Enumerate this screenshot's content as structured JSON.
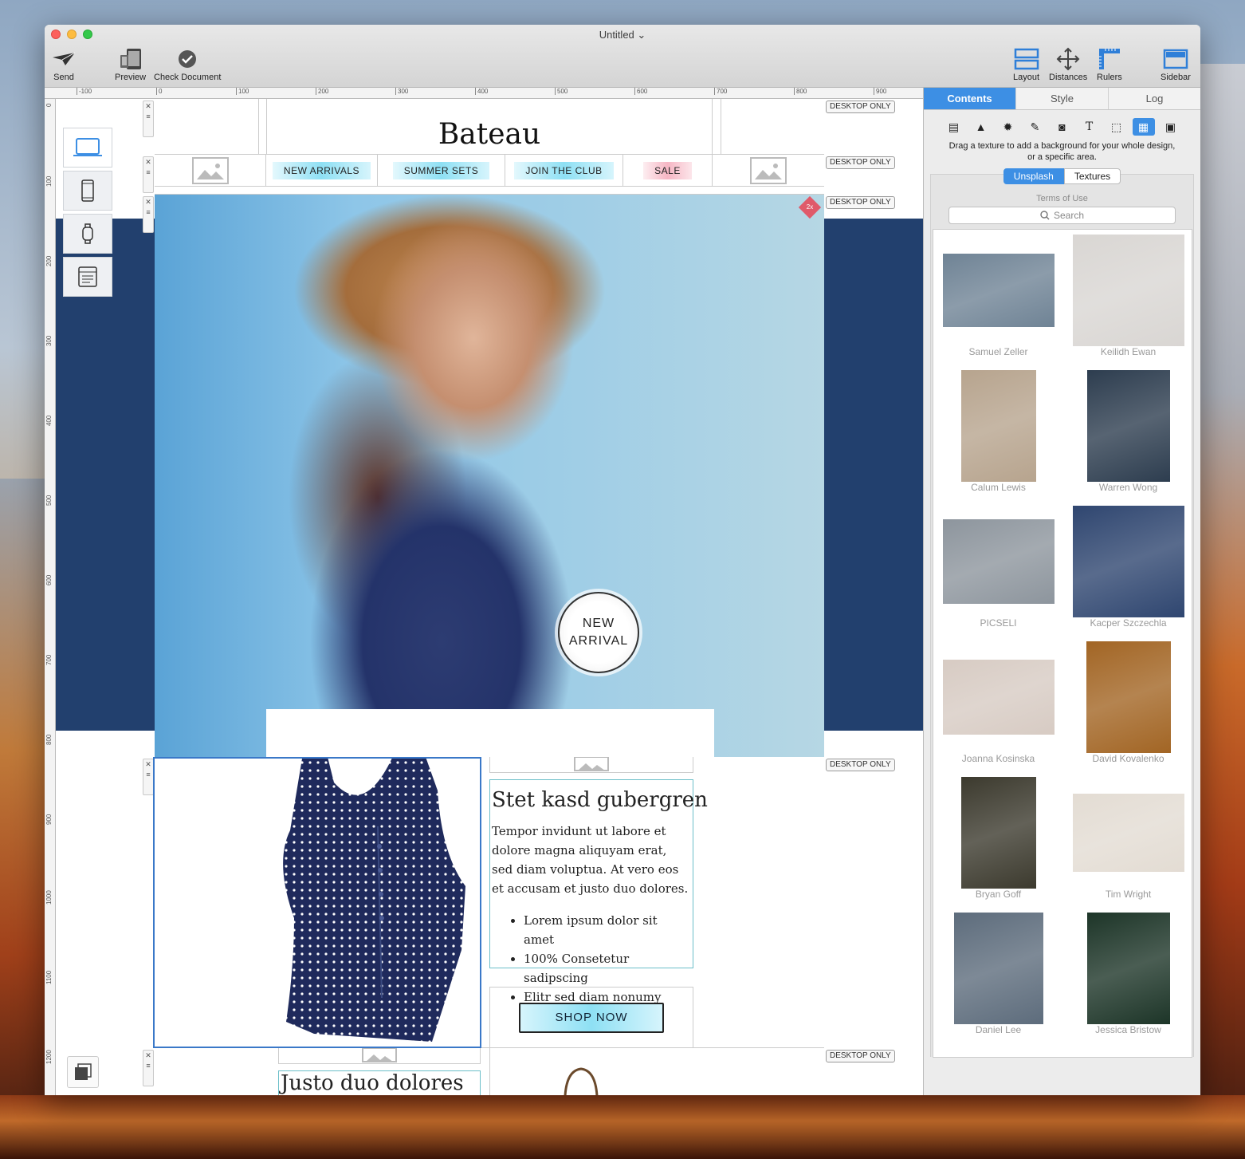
{
  "window": {
    "title": "Untitled"
  },
  "toolbar": {
    "left": [
      {
        "label": "Send",
        "icon": "paper-plane-icon"
      },
      {
        "label": "Preview",
        "icon": "devices-icon"
      },
      {
        "label": "Check Document",
        "icon": "checkmark-icon"
      }
    ],
    "right": [
      {
        "label": "Layout",
        "icon": "layout-icon"
      },
      {
        "label": "Distances",
        "icon": "distances-icon"
      },
      {
        "label": "Rulers",
        "icon": "rulers-icon"
      },
      {
        "label": "Sidebar",
        "icon": "sidebar-icon"
      }
    ]
  },
  "rulers": {
    "horizontal": [
      "-100",
      "0",
      "100",
      "200",
      "300",
      "400",
      "500",
      "600",
      "700",
      "800",
      "900"
    ],
    "vertical": [
      "0",
      "100",
      "200",
      "300",
      "400",
      "500",
      "600",
      "700",
      "800",
      "900",
      "1000",
      "1100",
      "1200"
    ]
  },
  "email": {
    "brand": "Bateau",
    "nav": [
      "NEW ARRIVALS",
      "SUMMER SETS",
      "JOIN THE CLUB",
      "SALE"
    ],
    "desktop_only": "DESKTOP ONLY",
    "hero_badge": "2x",
    "new_arrival": {
      "line1": "NEW",
      "line2": "ARRIVAL"
    },
    "product": {
      "title": "Stet kasd gubergren",
      "body": "Tempor invidunt ut labore et dolore magna aliquyam erat, sed diam voluptua. At vero eos et accusam et justo duo dolores.",
      "bullets": [
        "Lorem ipsum dolor sit amet",
        "100% Consetetur sadipscing",
        "Elitr sed diam nonumy"
      ],
      "cta": "SHOP NOW"
    },
    "next_title": "Justo duo dolores"
  },
  "sidebar": {
    "tabs": [
      "Contents",
      "Style",
      "Log"
    ],
    "active_tab": "Contents",
    "hint": "Drag a texture to add a background for your whole design, or a specific area.",
    "sources": [
      "Unsplash",
      "Textures"
    ],
    "terms": "Terms of Use",
    "search_placeholder": "Search",
    "thumbs": [
      {
        "name": "Samuel Zeller",
        "color": "#6f8395"
      },
      {
        "name": "Keilidh Ewan",
        "color": "#d9d6d3"
      },
      {
        "name": "Calum Lewis",
        "color": "#b7a48e"
      },
      {
        "name": "Warren Wong",
        "color": "#2d3d4f"
      },
      {
        "name": "PICSELI",
        "color": "#8d959d"
      },
      {
        "name": "Kacper Szczechla",
        "color": "#2f4670"
      },
      {
        "name": "Joanna Kosinska",
        "color": "#d7cbc3"
      },
      {
        "name": "David Kovalenko",
        "color": "#a26524"
      },
      {
        "name": "Bryan Goff",
        "color": "#3c3a2e"
      },
      {
        "name": "Tim Wright",
        "color": "#e3dcd3"
      },
      {
        "name": "Daniel Lee",
        "color": "#5d6c7c"
      },
      {
        "name": "Jessica Bristow",
        "color": "#1d3528"
      },
      {
        "name": "",
        "color": "#2f5a3c"
      },
      {
        "name": "",
        "color": "#3a4b5a"
      }
    ]
  },
  "colors": {
    "accent": "#3d8fe4",
    "band": "#22406e",
    "selection": "#3a78c8",
    "textbox": "#6cbfc9"
  }
}
